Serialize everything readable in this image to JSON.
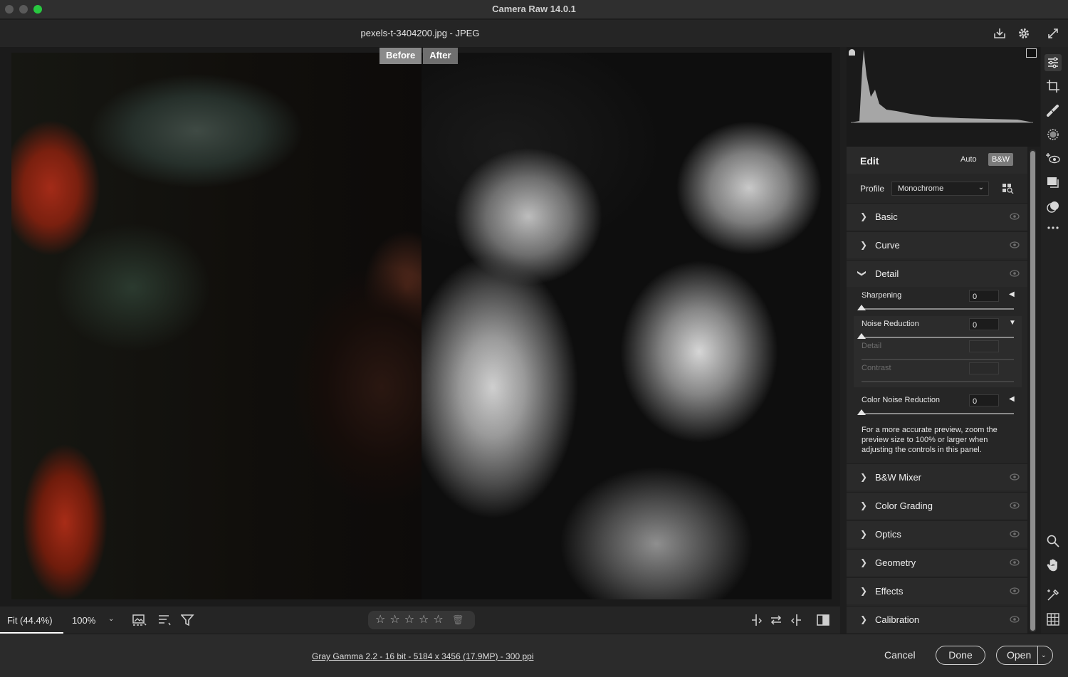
{
  "window": {
    "title": "Camera Raw 14.0.1"
  },
  "file": {
    "title": "pexels-t-3404200.jpg  -  JPEG"
  },
  "compare": {
    "before": "Before",
    "after": "After"
  },
  "toolbar": {
    "zoom_fit": "Fit (44.4%)",
    "zoom_100": "100%",
    "zoom_caret": "⌄",
    "stars": [
      "☆",
      "☆",
      "☆",
      "☆",
      "☆"
    ],
    "trash": "🗑"
  },
  "edit": {
    "title": "Edit",
    "auto_label": "Auto",
    "bw_label": "B&W",
    "profile_label": "Profile",
    "profile_value": "Monochrome",
    "sections": {
      "basic": "Basic",
      "curve": "Curve",
      "detail": "Detail",
      "bw_mixer": "B&W Mixer",
      "color_grading": "Color Grading",
      "optics": "Optics",
      "geometry": "Geometry",
      "effects": "Effects",
      "calibration": "Calibration"
    },
    "detail": {
      "sharpening_label": "Sharpening",
      "sharpening_value": "0",
      "noise_label": "Noise Reduction",
      "noise_value": "0",
      "nr_detail_label": "Detail",
      "nr_contrast_label": "Contrast",
      "color_noise_label": "Color Noise Reduction",
      "color_noise_value": "0",
      "note": "For a more accurate preview, zoom the preview size to 100% or larger when adjusting the controls in this panel."
    }
  },
  "footer": {
    "file_info": "Gray Gamma 2.2 - 16 bit - 5184 x 3456 (17.9MP) - 300 ppi",
    "cancel": "Cancel",
    "done": "Done",
    "open": "Open"
  },
  "icons": {
    "header": [
      "save-icon",
      "gear-icon",
      "fullscreen-icon"
    ],
    "tools": [
      "edit-sliders-icon",
      "crop-icon",
      "healing-brush-icon",
      "masking-icon",
      "red-eye-icon",
      "snapshots-icon",
      "presets-icon",
      "more-icon",
      "zoom-icon",
      "hand-icon",
      "color-sampler-icon",
      "grid-overlay-icon"
    ]
  },
  "colors": {
    "accent_green": "#28c840",
    "panel_bg": "#262626",
    "canvas_bg": "#1b1b1b"
  }
}
